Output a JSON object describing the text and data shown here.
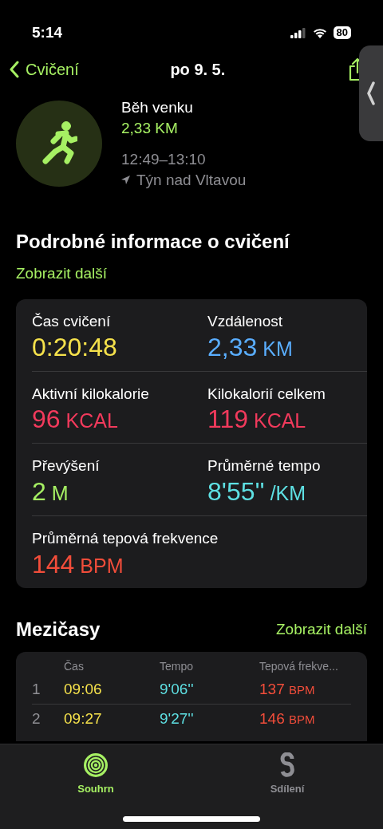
{
  "status_bar": {
    "time": "5:14",
    "battery": "80"
  },
  "nav": {
    "back": "Cvičení",
    "title": "po 9. 5."
  },
  "workout": {
    "name": "Běh venku",
    "distance": "2,33 KM",
    "time_range": "12:49–13:10",
    "location": "Týn nad Vltavou"
  },
  "details": {
    "title": "Podrobné informace o cvičení",
    "more": "Zobrazit další",
    "metrics": [
      {
        "label": "Čas cvičení",
        "value": "0:20:48",
        "color": "#f5e14b"
      },
      {
        "label": "Vzdálenost",
        "value": "2,33",
        "unit": "KM",
        "color": "#5aaeff"
      },
      {
        "label": "Aktivní kilokalorie",
        "value": "96",
        "unit": "KCAL",
        "color": "#f23a5c"
      },
      {
        "label": "Kilokalorií celkem",
        "value": "119",
        "unit": "KCAL",
        "color": "#f23a5c"
      },
      {
        "label": "Převýšení",
        "value": "2",
        "unit": "M",
        "color": "#a6f063"
      },
      {
        "label": "Průměrné tempo",
        "value": "8'55''",
        "unit": "/KM",
        "color": "#5ee0e3"
      },
      {
        "label": "Průměrná tepová frekvence",
        "value": "144",
        "unit": "BPM",
        "color": "#f24d3a"
      }
    ]
  },
  "splits": {
    "title": "Mezičasy",
    "more": "Zobrazit další",
    "columns": [
      "Čas",
      "Tempo",
      "Tepová frekve..."
    ],
    "rows": [
      {
        "index": "1",
        "time": "09:06",
        "pace": "9'06''",
        "hr": "137",
        "hr_unit": "BPM"
      },
      {
        "index": "2",
        "time": "09:27",
        "pace": "9'27''",
        "hr": "146",
        "hr_unit": "BPM"
      }
    ]
  },
  "tabs": [
    {
      "label": "Souhrn",
      "selected": true
    },
    {
      "label": "Sdílení",
      "selected": false
    }
  ]
}
